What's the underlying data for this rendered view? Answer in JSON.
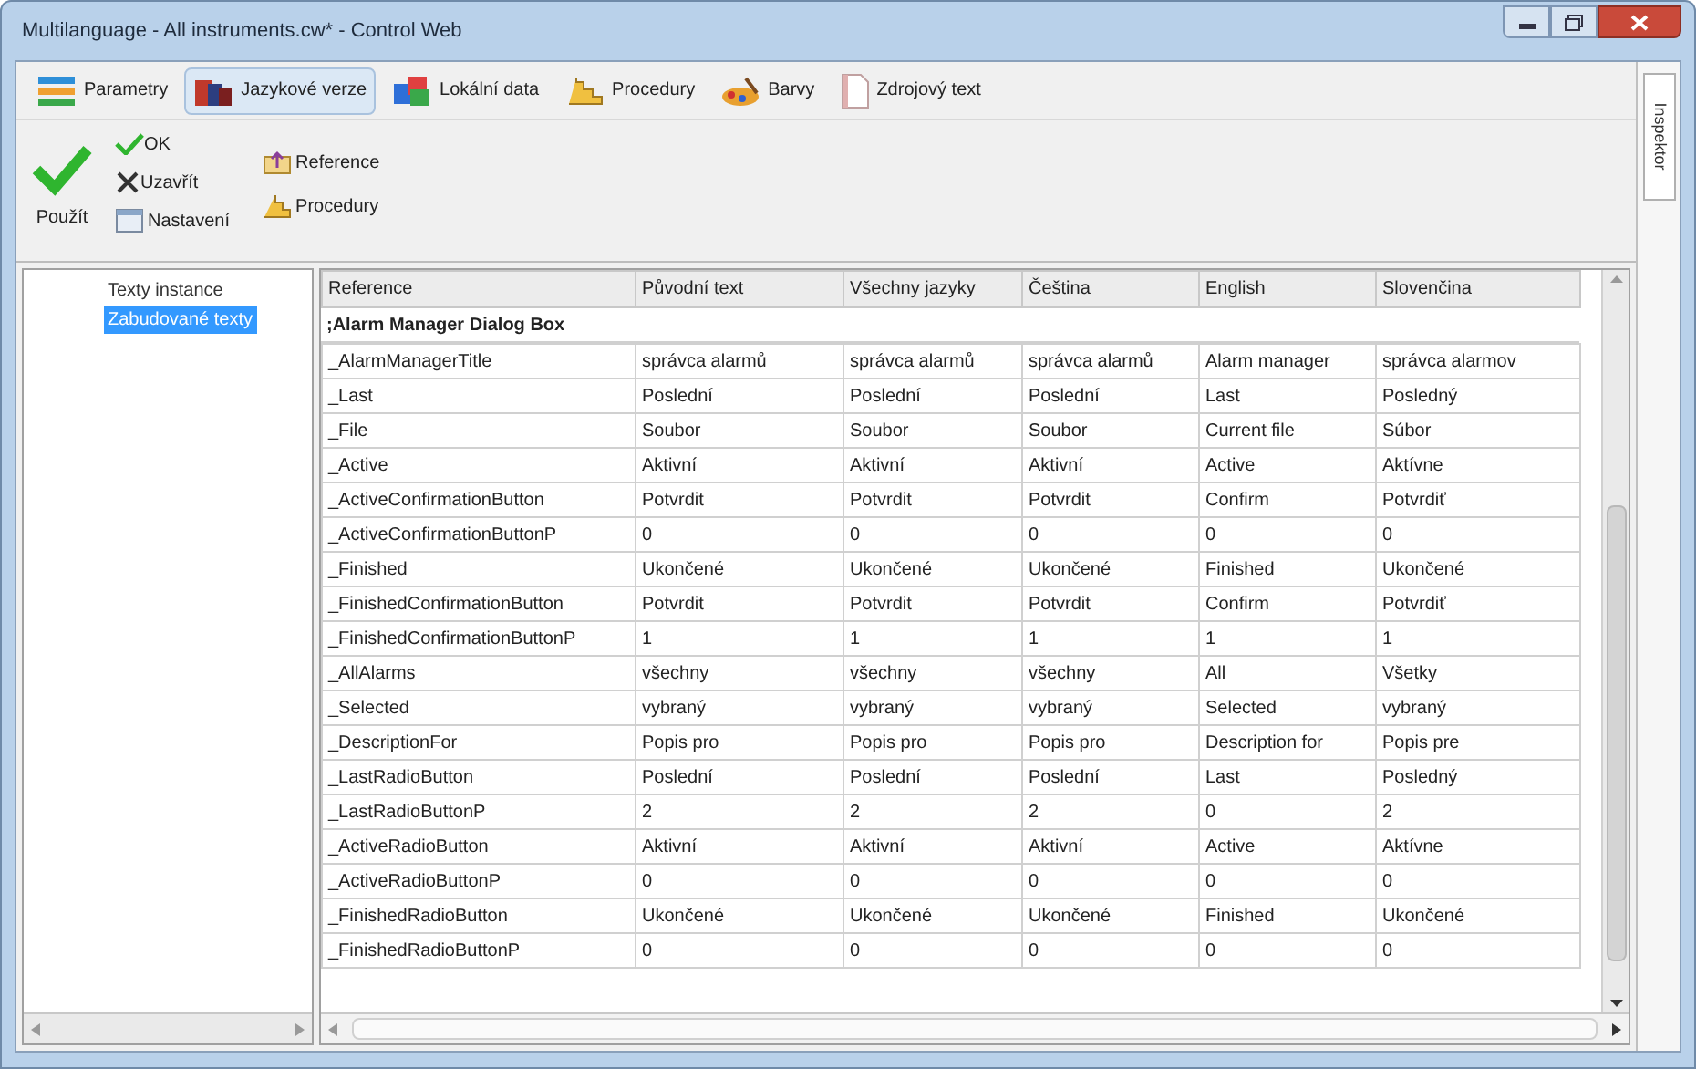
{
  "window": {
    "title": "Multilanguage - All instruments.cw* - Control Web"
  },
  "tabs": [
    {
      "label": "Parametry",
      "selected": false
    },
    {
      "label": "Jazykové verze",
      "selected": true
    },
    {
      "label": "Lokální data",
      "selected": false
    },
    {
      "label": "Procedury",
      "selected": false
    },
    {
      "label": "Barvy",
      "selected": false
    },
    {
      "label": "Zdrojový text",
      "selected": false
    }
  ],
  "ribbon": {
    "apply": "Použít",
    "ok": "OK",
    "close": "Uzavřít",
    "settings": "Nastavení",
    "reference": "Reference",
    "procedures": "Procedury"
  },
  "side_tab": "Inspektor",
  "tree": [
    {
      "label": "Texty instance",
      "selected": false
    },
    {
      "label": "Zabudované texty",
      "selected": true
    }
  ],
  "table": {
    "columns": [
      "Reference",
      "Původní text",
      "Všechny jazyky",
      "Čeština",
      "English",
      "Slovenčina"
    ],
    "group": ";Alarm Manager Dialog Box",
    "rows": [
      {
        "kind": "entry",
        "cells": [
          "_AlarmManagerTitle",
          "správca alarmů",
          "správca alarmů",
          "správca alarmů",
          "Alarm manager",
          "správca alarmov"
        ]
      },
      {
        "kind": "entry",
        "cells": [
          "_Last",
          "Poslední",
          "Poslední",
          "Poslední",
          "Last",
          "Posledný"
        ]
      },
      {
        "kind": "entry",
        "cells": [
          "_File",
          "Soubor",
          "Soubor",
          "Soubor",
          "Current file",
          "Súbor"
        ]
      },
      {
        "kind": "entry",
        "cells": [
          "_Active",
          "Aktivní",
          "Aktivní",
          "Aktivní",
          "Active",
          "Aktívne"
        ]
      },
      {
        "kind": "entry",
        "cells": [
          "_ActiveConfirmationButton",
          "Potvrdit",
          "Potvrdit",
          "Potvrdit",
          "Confirm",
          "Potvrdiť"
        ]
      },
      {
        "kind": "entry",
        "cells": [
          "_ActiveConfirmationButtonP",
          "0",
          "0",
          "0",
          "0",
          "0"
        ]
      },
      {
        "kind": "entry",
        "cells": [
          "_Finished",
          "Ukončené",
          "Ukončené",
          "Ukončené",
          "Finished",
          "Ukončené"
        ]
      },
      {
        "kind": "entry",
        "cells": [
          "_FinishedConfirmationButton",
          "Potvrdit",
          "Potvrdit",
          "Potvrdit",
          "Confirm",
          "Potvrdiť"
        ]
      },
      {
        "kind": "entry",
        "cells": [
          "_FinishedConfirmationButtonP",
          "1",
          "1",
          "1",
          "1",
          "1"
        ]
      },
      {
        "kind": "entry",
        "cells": [
          "_AllAlarms",
          "všechny",
          "všechny",
          "všechny",
          "All",
          "Všetky"
        ]
      },
      {
        "kind": "entry",
        "cells": [
          "_Selected",
          "vybraný",
          "vybraný",
          "vybraný",
          "Selected",
          "vybraný"
        ]
      },
      {
        "kind": "entry",
        "cells": [
          "_DescriptionFor",
          "Popis pro",
          "Popis pro",
          "Popis pro",
          "Description for",
          "Popis pre"
        ]
      },
      {
        "kind": "entry",
        "cells": [
          "_LastRadioButton",
          "Poslední",
          "Poslední",
          "Poslední",
          "Last",
          "Posledný"
        ]
      },
      {
        "kind": "entry",
        "cells": [
          "_LastRadioButtonP",
          "2",
          "2",
          "2",
          "0",
          "2"
        ]
      },
      {
        "kind": "entry",
        "cells": [
          "_ActiveRadioButton",
          "Aktivní",
          "Aktivní",
          "Aktivní",
          "Active",
          "Aktívne"
        ]
      },
      {
        "kind": "entry",
        "cells": [
          "_ActiveRadioButtonP",
          "0",
          "0",
          "0",
          "0",
          "0"
        ]
      },
      {
        "kind": "entry",
        "cells": [
          "_FinishedRadioButton",
          "Ukončené",
          "Ukončené",
          "Ukončené",
          "Finished",
          "Ukončené"
        ]
      },
      {
        "kind": "entry",
        "cells": [
          "_FinishedRadioButtonP",
          "0",
          "0",
          "0",
          "0",
          "0"
        ]
      }
    ]
  }
}
